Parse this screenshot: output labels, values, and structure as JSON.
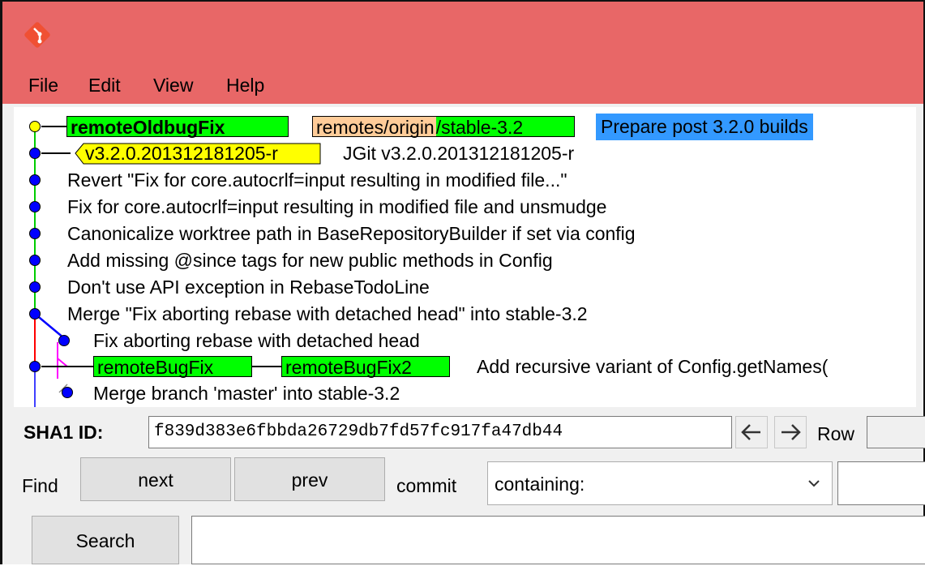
{
  "window": {
    "title": "",
    "icon": "git-diamond-icon",
    "colors": {
      "titlebar": "#e86767"
    }
  },
  "menu": {
    "items": [
      {
        "label": "File"
      },
      {
        "label": "Edit"
      },
      {
        "label": "View"
      },
      {
        "label": "Help"
      }
    ]
  },
  "graph": {
    "colors": {
      "node": "#0000ff",
      "head_node": "#ffff00",
      "branch_line": "#00cc00",
      "merge_line_red": "#ff0000",
      "merge_line_blue": "#0000ff",
      "merge_line_magenta": "#ff00ff",
      "local_branch_bg": "#00ff00",
      "remote_prefix_bg": "#ffcc99",
      "tag_bg": "#ffff00",
      "selected_bg": "#3399ff"
    },
    "commits": [
      {
        "refs": [
          {
            "text": "remoteOldbugFix",
            "kind": "head-branch"
          },
          {
            "prefix": "remotes/origin",
            "text": "/stable-3.2",
            "kind": "remote"
          }
        ],
        "subject": "Prepare post 3.2.0 builds",
        "selected": true
      },
      {
        "refs": [
          {
            "text": "v3.2.0.201312181205-r",
            "kind": "tag"
          }
        ],
        "subject": "JGit v3.2.0.201312181205-r"
      },
      {
        "refs": [],
        "subject": "Revert \"Fix for core.autocrlf=input resulting in modified file...\""
      },
      {
        "refs": [],
        "subject": "Fix for core.autocrlf=input resulting in modified file and unsmudge"
      },
      {
        "refs": [],
        "subject": "Canonicalize worktree path in BaseRepositoryBuilder if set via config"
      },
      {
        "refs": [],
        "subject": "Add missing @since tags for new public methods in Config"
      },
      {
        "refs": [],
        "subject": "Don't use API exception in RebaseTodoLine"
      },
      {
        "refs": [],
        "subject": "Merge \"Fix aborting rebase with detached head\" into stable-3.2"
      },
      {
        "refs": [],
        "subject": "Fix aborting rebase with detached head"
      },
      {
        "refs": [
          {
            "text": "remoteBugFix",
            "kind": "branch"
          },
          {
            "text": "remoteBugFix2",
            "kind": "branch"
          }
        ],
        "subject": "Add recursive variant of Config.getNames("
      },
      {
        "refs": [],
        "subject": "Merge branch 'master' into stable-3.2"
      }
    ]
  },
  "sha": {
    "label": "SHA1 ID:",
    "value": "f839d383e6fbbda26729db7fd57fc917fa47db44",
    "back_icon": "arrow-left-icon",
    "forward_icon": "arrow-right-icon",
    "row_label": "Row"
  },
  "find": {
    "label": "Find",
    "next_label": "next",
    "prev_label": "prev",
    "commit_label": "commit",
    "mode_value": "containing:"
  },
  "search": {
    "button_label": "Search"
  }
}
